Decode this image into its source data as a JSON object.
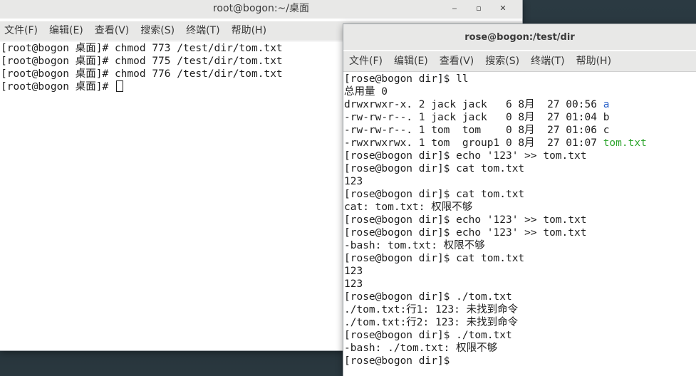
{
  "root_window": {
    "title": "root@bogon:~/桌面",
    "controls": [
      "‒",
      "▫",
      "✕"
    ],
    "menu": [
      "文件(F)",
      "编辑(E)",
      "查看(V)",
      "搜索(S)",
      "终端(T)",
      "帮助(H)"
    ],
    "lines": [
      "[root@bogon 桌面]# chmod 773 /test/dir/tom.txt",
      "[root@bogon 桌面]# chmod 775 /test/dir/tom.txt",
      "[root@bogon 桌面]# chmod 776 /test/dir/tom.txt",
      "[root@bogon 桌面]# "
    ]
  },
  "rose_window": {
    "title": "rose@bogon:/test/dir",
    "menu": [
      "文件(F)",
      "编辑(E)",
      "查看(V)",
      "搜索(S)",
      "终端(T)",
      "帮助(H)"
    ],
    "lines": [
      "[rose@bogon dir]$ ll",
      "总用量 0",
      {
        "text": "drwxrwxr-x. 2 jack jack   6 8月  27 00:56 ",
        "name": "a",
        "color": "blue"
      },
      {
        "text": "-rw-rw-r--. 1 jack jack   0 8月  27 01:04 ",
        "name": "b"
      },
      {
        "text": "-rw-rw-r--. 1 tom  tom    0 8月  27 01:06 ",
        "name": "c"
      },
      {
        "text": "-rwxrwxrwx. 1 tom  group1 0 8月  27 01:07 ",
        "name": "tom.txt",
        "color": "green"
      },
      "[rose@bogon dir]$ echo '123' >> tom.txt",
      "[rose@bogon dir]$ cat tom.txt",
      "123",
      "[rose@bogon dir]$ cat tom.txt",
      "cat: tom.txt: 权限不够",
      "[rose@bogon dir]$ echo '123' >> tom.txt",
      "[rose@bogon dir]$ echo '123' >> tom.txt",
      "-bash: tom.txt: 权限不够",
      "[rose@bogon dir]$ cat tom.txt",
      "123",
      "123",
      "[rose@bogon dir]$ ./tom.txt",
      "./tom.txt:行1: 123: 未找到命令",
      "./tom.txt:行2: 123: 未找到命令",
      "[rose@bogon dir]$ ./tom.txt",
      "-bash: ./tom.txt: 权限不够",
      "[rose@bogon dir]$ "
    ]
  }
}
